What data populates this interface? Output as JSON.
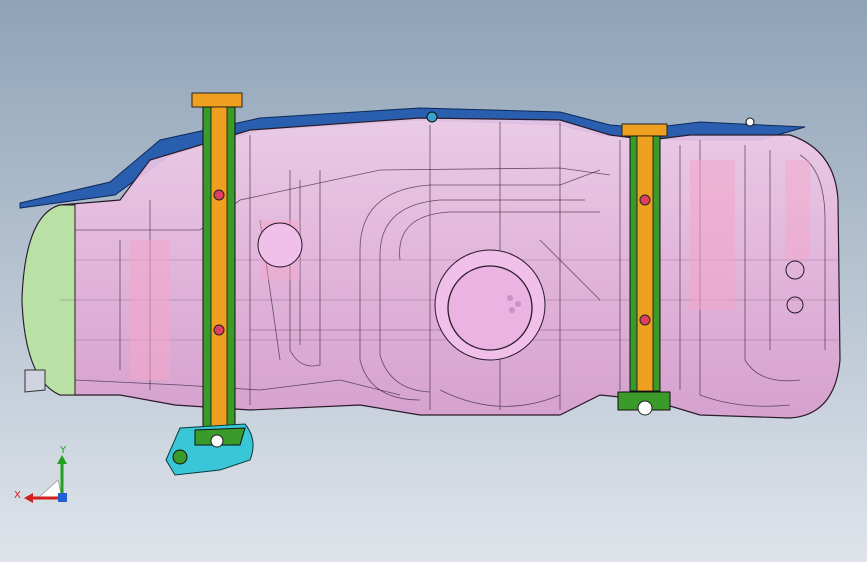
{
  "viewport": {
    "background_top": "#8fa3b8",
    "background_bottom": "#dfe4ea"
  },
  "model": {
    "tank_fill": "#e8b7e0",
    "tank_stroke": "#2a1a2a",
    "flange_color": "#2a5fb0",
    "strap_green": "#3a9a2a",
    "strap_orange": "#f0a020",
    "bracket_cyan": "#39c6d6",
    "end_cap_green": "#b9e0a5",
    "inner_pink": "#f4a6c8"
  },
  "triad": {
    "x_label": "X",
    "y_label": "Y",
    "x_color": "#d22020",
    "y_color": "#20a020",
    "z_color": "#2060d0"
  }
}
